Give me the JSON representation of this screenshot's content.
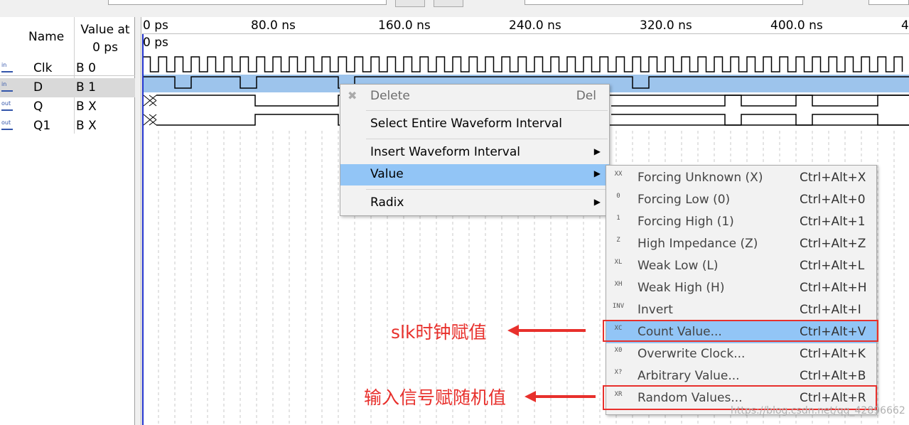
{
  "signal_panel": {
    "header_name": "Name",
    "header_value_line1": "Value at",
    "header_value_line2": "0 ps",
    "signals": [
      {
        "icon": "in",
        "name": "Clk",
        "value": "B 0"
      },
      {
        "icon": "in",
        "name": "D",
        "value": "B 1"
      },
      {
        "icon": "out",
        "name": "Q",
        "value": "B X"
      },
      {
        "icon": "out",
        "name": "Q1",
        "value": "B X"
      }
    ]
  },
  "waveform": {
    "time_ticks": [
      "0 ps",
      "80.0 ns",
      "160.0 ns",
      "240.0 ns",
      "320.0 ns",
      "400.0 ns",
      "4"
    ],
    "cursor_label": "0 ps"
  },
  "context_menu": {
    "items": [
      {
        "label": "Delete",
        "shortcut": "Del",
        "disabled": true
      },
      {
        "label": "Select Entire Waveform Interval",
        "shortcut": ""
      },
      {
        "label": "Insert Waveform Interval",
        "shortcut": "",
        "submenu": true
      },
      {
        "label": "Value",
        "shortcut": "",
        "submenu": true,
        "highlighted": true
      },
      {
        "label": "Radix",
        "shortcut": "",
        "submenu": true
      }
    ]
  },
  "value_submenu": {
    "items": [
      {
        "icon": "forcing-unknown-icon",
        "glyph": "XX",
        "label": "Forcing Unknown (X)",
        "shortcut": "Ctrl+Alt+X"
      },
      {
        "icon": "forcing-low-icon",
        "glyph": "0",
        "label": "Forcing Low (0)",
        "shortcut": "Ctrl+Alt+0"
      },
      {
        "icon": "forcing-high-icon",
        "glyph": "1",
        "label": "Forcing High (1)",
        "shortcut": "Ctrl+Alt+1"
      },
      {
        "icon": "high-impedance-icon",
        "glyph": "Z",
        "label": "High Impedance (Z)",
        "shortcut": "Ctrl+Alt+Z"
      },
      {
        "icon": "weak-low-icon",
        "glyph": "XL",
        "label": "Weak Low (L)",
        "shortcut": "Ctrl+Alt+L"
      },
      {
        "icon": "weak-high-icon",
        "glyph": "XH",
        "label": "Weak High (H)",
        "shortcut": "Ctrl+Alt+H"
      },
      {
        "icon": "invert-icon",
        "glyph": "INV",
        "label": "Invert",
        "shortcut": "Ctrl+Alt+I"
      },
      {
        "icon": "count-value-icon",
        "glyph": "XC",
        "label": "Count Value...",
        "shortcut": "Ctrl+Alt+V",
        "highlighted": true
      },
      {
        "icon": "overwrite-clock-icon",
        "glyph": "X0",
        "label": "Overwrite Clock...",
        "shortcut": "Ctrl+Alt+K"
      },
      {
        "icon": "arbitrary-value-icon",
        "glyph": "X?",
        "label": "Arbitrary Value...",
        "shortcut": "Ctrl+Alt+B"
      },
      {
        "icon": "random-values-icon",
        "glyph": "XR",
        "label": "Random Values...",
        "shortcut": "Ctrl+Alt+R"
      }
    ]
  },
  "annotations": {
    "clock_note": "slk时钟赋值",
    "random_note": "输入信号赋随机值",
    "color": "#e8302c"
  },
  "watermark": "https://blog.csdn.net/qq_42896662",
  "colors": {
    "menu_highlight": "#92c5f6",
    "selected_row_wave": "#9dc4ec",
    "cursor": "#2233cc"
  }
}
